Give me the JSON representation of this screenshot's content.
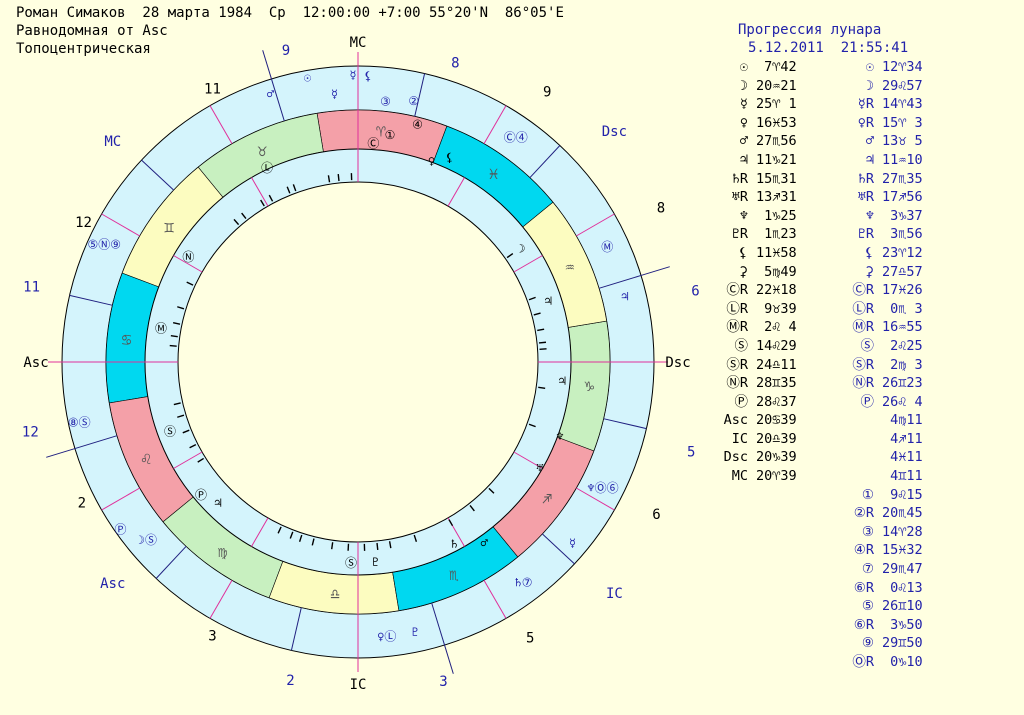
{
  "header": {
    "line1": "Роман Симаков  28 марта 1984  Ср  12:00:00 +7:00 55°20'N  86°05'E",
    "line2": "Равнодомная от Asc",
    "line3": "Топоцентрическая"
  },
  "progression": {
    "title": "Прогрессия лунара",
    "datetime": "5.12.2011  21:55:41"
  },
  "colors": {
    "fire": "#f4a0a8",
    "earth": "#c8f0c0",
    "air": "#fcfcc0",
    "water": "#00d8f0",
    "ring_bg": "#d4f4fc",
    "house_line": "#e0309a",
    "axis_line": "#202080",
    "label_blue": "#2222aa"
  },
  "chart": {
    "outer_house_labels": [
      "9",
      "8",
      "9",
      "Dsc",
      "8",
      "6",
      "Dsc",
      "5",
      "6",
      "IC",
      "5",
      "3",
      "IC",
      "2",
      "3",
      "Asc",
      "2",
      "12",
      "Asc",
      "11",
      "12",
      "MC",
      "11"
    ],
    "outer_labels": [
      {
        "id": "mc-top",
        "text": "MC"
      },
      {
        "id": "h9-top",
        "text": "9"
      },
      {
        "id": "h8-top",
        "text": "8"
      },
      {
        "id": "h9-right",
        "text": "9"
      },
      {
        "id": "dsc-outer",
        "text": "Dsc"
      },
      {
        "id": "h8-right",
        "text": "8"
      },
      {
        "id": "h6-right",
        "text": "6"
      },
      {
        "id": "dsc-mid",
        "text": "Dsc"
      },
      {
        "id": "h5-right",
        "text": "5"
      },
      {
        "id": "h6-low",
        "text": "6"
      },
      {
        "id": "ic-right",
        "text": "IC"
      },
      {
        "id": "h5-low",
        "text": "5"
      },
      {
        "id": "h3-bottom",
        "text": "3"
      },
      {
        "id": "ic-bottom",
        "text": "IC"
      },
      {
        "id": "h2-bottom",
        "text": "2"
      },
      {
        "id": "h3-left",
        "text": "3"
      },
      {
        "id": "asc-lower",
        "text": "Asc"
      },
      {
        "id": "h2-left",
        "text": "2"
      },
      {
        "id": "h12-left",
        "text": "12"
      },
      {
        "id": "asc-mid",
        "text": "Asc"
      },
      {
        "id": "h11-left",
        "text": "11"
      },
      {
        "id": "h12-upper",
        "text": "12"
      },
      {
        "id": "mc-left",
        "text": "MC"
      },
      {
        "id": "h11-top",
        "text": "11"
      }
    ],
    "signs": [
      "♈",
      "♉",
      "♊",
      "♋",
      "♌",
      "♍",
      "♎",
      "♏",
      "♐",
      "♑",
      "♒",
      "♓"
    ]
  },
  "natal_table": [
    {
      "sym": "☉",
      "val": " 7♈42"
    },
    {
      "sym": "☽",
      "val": "20♒21"
    },
    {
      "sym": "☿",
      "val": "25♈ 1"
    },
    {
      "sym": "♀",
      "val": "16♓53"
    },
    {
      "sym": "♂",
      "val": "27♏56"
    },
    {
      "sym": "♃",
      "val": "11♑21"
    },
    {
      "sym": "♄R",
      "val": "15♏31"
    },
    {
      "sym": "♅R",
      "val": "13♐31"
    },
    {
      "sym": "♆",
      "val": " 1♑25"
    },
    {
      "sym": "♇R",
      "val": " 1♏23"
    },
    {
      "sym": "⚸",
      "val": "11♓58"
    },
    {
      "sym": "⚳",
      "val": " 5♍49"
    },
    {
      "sym": "ⒸR",
      "val": "22♓18"
    },
    {
      "sym": "ⓁR",
      "val": " 9♉39"
    },
    {
      "sym": "ⓂR",
      "val": " 2♌ 4"
    },
    {
      "sym": "Ⓢ",
      "val": "14♌29"
    },
    {
      "sym": "ⓈR",
      "val": "24♎11"
    },
    {
      "sym": "ⓃR",
      "val": "28♊35"
    },
    {
      "sym": "Ⓟ",
      "val": "28♌37"
    },
    {
      "sym": "Asc",
      "val": "20♋39"
    },
    {
      "sym": "IC",
      "val": "20♎39"
    },
    {
      "sym": "Dsc",
      "val": "20♑39"
    },
    {
      "sym": "MC",
      "val": "20♈39"
    }
  ],
  "prog_table": [
    {
      "sym": "☉",
      "val": "12♈34"
    },
    {
      "sym": "☽",
      "val": "29♌57"
    },
    {
      "sym": "☿R",
      "val": "14♈43"
    },
    {
      "sym": "♀R",
      "val": "15♈ 3"
    },
    {
      "sym": "♂",
      "val": "13♉ 5"
    },
    {
      "sym": "♃",
      "val": "11♒10"
    },
    {
      "sym": "♄R",
      "val": "27♏35"
    },
    {
      "sym": "♅R",
      "val": "17♐56"
    },
    {
      "sym": "♆",
      "val": " 3♑37"
    },
    {
      "sym": "♇R",
      "val": " 3♏56"
    },
    {
      "sym": "⚸",
      "val": "23♈12"
    },
    {
      "sym": "⚳",
      "val": "27♎57"
    },
    {
      "sym": "ⒸR",
      "val": "17♓26"
    },
    {
      "sym": "ⓁR",
      "val": " 0♏ 3"
    },
    {
      "sym": "ⓂR",
      "val": "16♒55"
    },
    {
      "sym": "Ⓢ",
      "val": " 2♌25"
    },
    {
      "sym": "ⓈR",
      "val": " 2♍ 3"
    },
    {
      "sym": "ⓃR",
      "val": "26♊23"
    },
    {
      "sym": "Ⓟ",
      "val": "26♌ 4"
    },
    {
      "sym": "",
      "val": " 4♍11"
    },
    {
      "sym": "",
      "val": " 4♐11"
    },
    {
      "sym": "",
      "val": " 4♓11"
    },
    {
      "sym": "",
      "val": " 4♊11"
    },
    {
      "sym": "①",
      "val": " 9♌15"
    },
    {
      "sym": "②R",
      "val": "20♏45"
    },
    {
      "sym": "③",
      "val": "14♈28"
    },
    {
      "sym": "④R",
      "val": "15♓32"
    },
    {
      "sym": "⑦",
      "val": "29♏47"
    },
    {
      "sym": "⑥R",
      "val": " 0♌13"
    },
    {
      "sym": "⑤",
      "val": "26♊10"
    },
    {
      "sym": "⑥R",
      "val": " 3♑50"
    },
    {
      "sym": "⑨",
      "val": "29♊50"
    },
    {
      "sym": "ⓄR",
      "val": " 0♑10"
    }
  ]
}
